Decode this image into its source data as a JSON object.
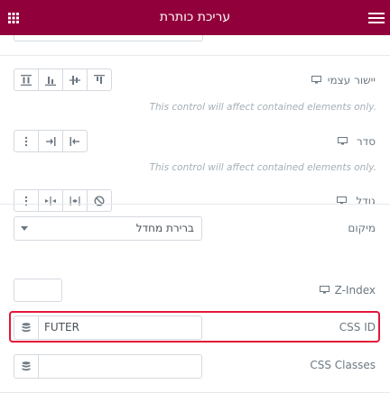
{
  "header": {
    "title": "עריכת כותרת",
    "accent_color": "#92003b",
    "menu_icon": "hamburger-icon",
    "grid_icon": "apps-grid-icon"
  },
  "controls": {
    "self_align": {
      "label": "יישור עצמי",
      "note": "This control will affect contained elements only."
    },
    "order": {
      "label": "סדר",
      "note": "This control will affect contained elements only."
    },
    "size": {
      "label": "גודל"
    },
    "position": {
      "label": "מיקום",
      "value": "ברירת מחדל"
    },
    "z_index": {
      "label": "Z-Index",
      "value": ""
    },
    "css_id": {
      "label": "CSS ID",
      "value": "FUTER"
    },
    "css_classes": {
      "label": "CSS Classes",
      "value": ""
    }
  },
  "highlight_color": "#e3173a"
}
